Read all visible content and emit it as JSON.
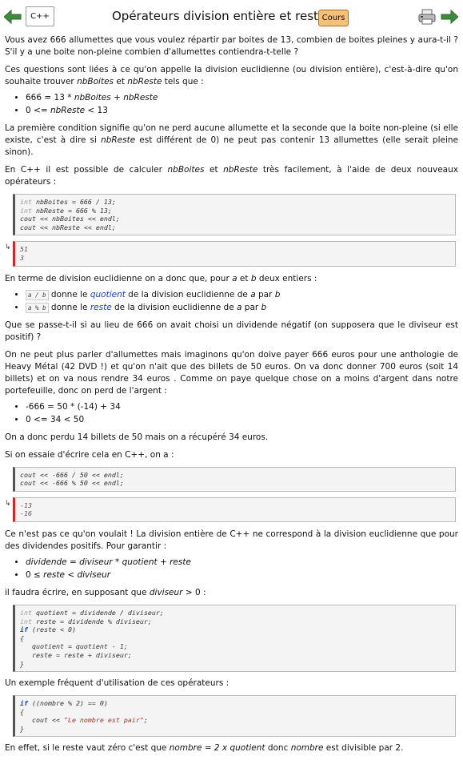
{
  "header": {
    "tag": "C++",
    "title": "Opérateurs division entière et reste",
    "badge": "Cours"
  },
  "p1": "Vous avez 666 allumettes que vous voulez répartir par boites de 13, combien de boites pleines y aura-t-il ? S'il y a une boite non-pleine combien d'allumettes contiendra-t-telle ?",
  "p2a": "Ces questions sont liées à ce qu'on appelle la division euclidienne (ou division entière), c'est-à-dire qu'on souhaite trouver ",
  "p2b": "nbBoites",
  "p2c": " et ",
  "p2d": "nbReste",
  "p2e": " tels que :",
  "list1": {
    "i1a": "666 = 13 * ",
    "i1b": "nbBoites",
    "i1c": " + ",
    "i1d": "nbReste",
    "i2a": "0 <= ",
    "i2b": "nbReste",
    "i2c": " < 13"
  },
  "p3a": "La première condition signifie qu'on ne perd aucune allumette et la seconde que la boite non-pleine (si elle existe, c'est à dire si ",
  "p3b": "nbReste",
  "p3c": " est différent de 0) ne peut pas contenir 13 allumettes (elle serait pleine sinon).",
  "p4a": "En C++ il est possible de calculer ",
  "p4b": "nbBoites",
  "p4c": " et ",
  "p4d": "nbReste",
  "p4e": " très facilement, à l'aide de deux nouveaux opérateurs :",
  "code1": {
    "l1_type": "int",
    "l1": " nbBoites = 666 / 13;",
    "l2_type": "int",
    "l2": " nbReste = 666 % 13;",
    "l3": "cout << nbBoites << endl;",
    "l4": "cout << nbReste << endl;"
  },
  "out1": {
    "arrow": "↳",
    "l1": "51",
    "l2": "3"
  },
  "p5a": "En terme de division euclidienne on a donc que, pour ",
  "p5b": "a",
  "p5c": " et ",
  "p5d": "b",
  "p5e": " deux entiers :",
  "list2": {
    "i1code": "a / b",
    "i1a": " donne le ",
    "i1b": "quotient",
    "i1c": " de la division euclidienne de ",
    "i1d": "a",
    "i1e": " par ",
    "i1f": "b",
    "i2code": "a % b",
    "i2a": " donne le ",
    "i2b": "reste",
    "i2c": " de la division euclidienne de ",
    "i2d": "a",
    "i2e": " par ",
    "i2f": "b"
  },
  "p6": "Que se passe-t-il si au lieu de 666 on avait choisi un dividende négatif (on supposera que le diviseur est positif) ?",
  "p7": "On ne peut plus parler d'allumettes mais imaginons qu'on doive payer 666 euros pour une anthologie de Heavy Métal (42 DVD !) et qu'on n'ait que des billets de 50 euros. On va donc donner 700 euros (soit 14 billets) et on va nous rendre 34 euros . Comme on paye quelque chose on a moins d'argent dans notre portefeuille, donc on perd de l'argent :",
  "list3": {
    "i1": "-666 = 50 * (-14) + 34",
    "i2": "0 <= 34 < 50"
  },
  "p8": "On a donc perdu 14 billets de 50 mais on a récupéré 34 euros.",
  "p9": "Si on essaie d'écrire cela en C++, on a :",
  "code2": {
    "l1": "cout << -666 / 50 << endl;",
    "l2": "cout << -666 % 50 << endl;"
  },
  "out2": {
    "arrow": "↳",
    "l1": "-13",
    "l2": "-16"
  },
  "p10": "Ce n'est pas ce qu'on voulait ! La division entière de C++ ne correspond à la division euclidienne que pour des dividendes positifs. Pour garantir :",
  "list4": {
    "i1": "dividende = diviseur * quotient + reste",
    "i2a": "0 ≤ ",
    "i2b": "reste",
    "i2c": " < ",
    "i2d": "diviseur"
  },
  "p11a": "il faudra écrire, en supposant que ",
  "p11b": "diviseur",
  "p11c": " > 0 :",
  "code3": {
    "l1_type": "int",
    "l1": " quotient = dividende / diviseur;",
    "l2_type": "int",
    "l2": " reste = dividende % diviseur;",
    "l3_kw": "if",
    "l3": " (reste < 0)",
    "l4": "{",
    "l5": "   quotient = quotient - 1;",
    "l6": "   reste = reste + diviseur;",
    "l7": "}"
  },
  "p12": "Un exemple fréquent d'utilisation de ces opérateurs :",
  "code4": {
    "l1_kw": "if",
    "l1": " ((nombre % 2) == 0)",
    "l2": "{",
    "l3a": "   cout << ",
    "l3b": "\"Le nombre est pair\"",
    "l3c": ";",
    "l4": "}"
  },
  "p13a": "En effet, si le reste vaut zéro c'est que ",
  "p13b": "nombre = 2 x quotient",
  "p13c": " donc ",
  "p13d": "nombre",
  "p13e": " est divisible par 2."
}
